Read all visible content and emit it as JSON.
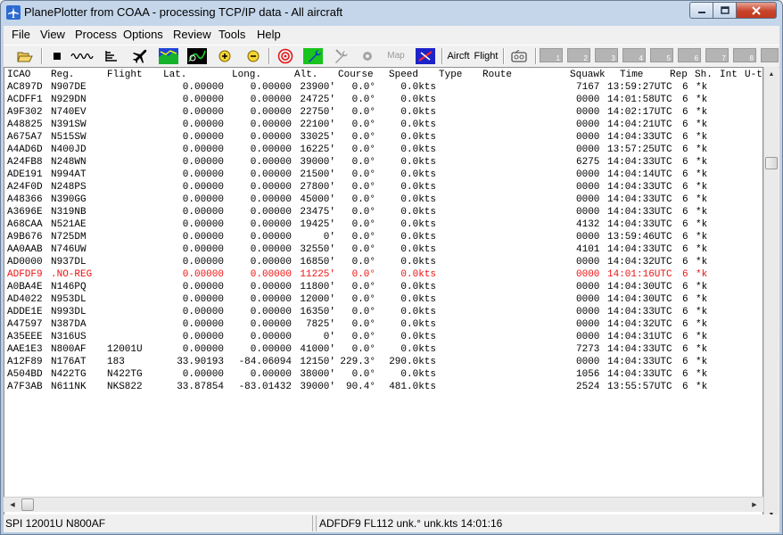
{
  "window": {
    "title": "PlanePlotter from COAA - processing TCP/IP data - All aircraft"
  },
  "menu": [
    "File",
    "View",
    "Process",
    "Options",
    "Review",
    "Tools",
    "Help"
  ],
  "toolbar": {
    "aircraft_label": "Aircft",
    "flight_label": "Flight",
    "map_label": "Map",
    "number_buttons": [
      "1",
      "2",
      "3",
      "4",
      "5",
      "6",
      "7",
      "8"
    ]
  },
  "columns": [
    "ICAO",
    "Reg.",
    "Flight",
    "Lat.",
    "Long.",
    "Alt.",
    "Course",
    "Speed",
    "Type",
    "Route",
    "Squawk",
    "Time",
    "Rep",
    "Sh.",
    "Int",
    "U-t"
  ],
  "aircraft": [
    {
      "icao": "AC897D",
      "reg": "N907DE",
      "flight": "",
      "lat": "0.00000",
      "lon": "0.00000",
      "alt": "23900'",
      "course": "0.0°",
      "speed": "0.0kts",
      "squawk": "7167",
      "time": "13:59:27UTC",
      "rep": "6",
      "sh": "*k",
      "red": false
    },
    {
      "icao": "ACDFF1",
      "reg": "N929DN",
      "flight": "",
      "lat": "0.00000",
      "lon": "0.00000",
      "alt": "24725'",
      "course": "0.0°",
      "speed": "0.0kts",
      "squawk": "0000",
      "time": "14:01:58UTC",
      "rep": "6",
      "sh": "*k",
      "red": false
    },
    {
      "icao": "A9F302",
      "reg": "N740EV",
      "flight": "",
      "lat": "0.00000",
      "lon": "0.00000",
      "alt": "22750'",
      "course": "0.0°",
      "speed": "0.0kts",
      "squawk": "0000",
      "time": "14:02:17UTC",
      "rep": "6",
      "sh": "*k",
      "red": false
    },
    {
      "icao": "A48825",
      "reg": "N391SW",
      "flight": "",
      "lat": "0.00000",
      "lon": "0.00000",
      "alt": "22100'",
      "course": "0.0°",
      "speed": "0.0kts",
      "squawk": "0000",
      "time": "14:04:21UTC",
      "rep": "6",
      "sh": "*k",
      "red": false
    },
    {
      "icao": "A675A7",
      "reg": "N515SW",
      "flight": "",
      "lat": "0.00000",
      "lon": "0.00000",
      "alt": "33025'",
      "course": "0.0°",
      "speed": "0.0kts",
      "squawk": "0000",
      "time": "14:04:33UTC",
      "rep": "6",
      "sh": "*k",
      "red": false
    },
    {
      "icao": "A4AD6D",
      "reg": "N400JD",
      "flight": "",
      "lat": "0.00000",
      "lon": "0.00000",
      "alt": "16225'",
      "course": "0.0°",
      "speed": "0.0kts",
      "squawk": "0000",
      "time": "13:57:25UTC",
      "rep": "6",
      "sh": "*k",
      "red": false
    },
    {
      "icao": "A24FB8",
      "reg": "N248WN",
      "flight": "",
      "lat": "0.00000",
      "lon": "0.00000",
      "alt": "39000'",
      "course": "0.0°",
      "speed": "0.0kts",
      "squawk": "6275",
      "time": "14:04:33UTC",
      "rep": "6",
      "sh": "*k",
      "red": false
    },
    {
      "icao": "ADE191",
      "reg": "N994AT",
      "flight": "",
      "lat": "0.00000",
      "lon": "0.00000",
      "alt": "21500'",
      "course": "0.0°",
      "speed": "0.0kts",
      "squawk": "0000",
      "time": "14:04:14UTC",
      "rep": "6",
      "sh": "*k",
      "red": false
    },
    {
      "icao": "A24F0D",
      "reg": "N248PS",
      "flight": "",
      "lat": "0.00000",
      "lon": "0.00000",
      "alt": "27800'",
      "course": "0.0°",
      "speed": "0.0kts",
      "squawk": "0000",
      "time": "14:04:33UTC",
      "rep": "6",
      "sh": "*k",
      "red": false
    },
    {
      "icao": "A48366",
      "reg": "N390GG",
      "flight": "",
      "lat": "0.00000",
      "lon": "0.00000",
      "alt": "45000'",
      "course": "0.0°",
      "speed": "0.0kts",
      "squawk": "0000",
      "time": "14:04:33UTC",
      "rep": "6",
      "sh": "*k",
      "red": false
    },
    {
      "icao": "A3696E",
      "reg": "N319NB",
      "flight": "",
      "lat": "0.00000",
      "lon": "0.00000",
      "alt": "23475'",
      "course": "0.0°",
      "speed": "0.0kts",
      "squawk": "0000",
      "time": "14:04:33UTC",
      "rep": "6",
      "sh": "*k",
      "red": false
    },
    {
      "icao": "A68CAA",
      "reg": "N521AE",
      "flight": "",
      "lat": "0.00000",
      "lon": "0.00000",
      "alt": "19425'",
      "course": "0.0°",
      "speed": "0.0kts",
      "squawk": "4132",
      "time": "14:04:33UTC",
      "rep": "6",
      "sh": "*k",
      "red": false
    },
    {
      "icao": "A9B676",
      "reg": "N725DM",
      "flight": "",
      "lat": "0.00000",
      "lon": "0.00000",
      "alt": "0'",
      "course": "0.0°",
      "speed": "0.0kts",
      "squawk": "0000",
      "time": "13:59:46UTC",
      "rep": "6",
      "sh": "*k",
      "red": false
    },
    {
      "icao": "AA0AAB",
      "reg": "N746UW",
      "flight": "",
      "lat": "0.00000",
      "lon": "0.00000",
      "alt": "32550'",
      "course": "0.0°",
      "speed": "0.0kts",
      "squawk": "4101",
      "time": "14:04:33UTC",
      "rep": "6",
      "sh": "*k",
      "red": false
    },
    {
      "icao": "AD0000",
      "reg": "N937DL",
      "flight": "",
      "lat": "0.00000",
      "lon": "0.00000",
      "alt": "16850'",
      "course": "0.0°",
      "speed": "0.0kts",
      "squawk": "0000",
      "time": "14:04:32UTC",
      "rep": "6",
      "sh": "*k",
      "red": false
    },
    {
      "icao": "ADFDF9",
      "reg": ".NO-REG",
      "flight": "",
      "lat": "0.00000",
      "lon": "0.00000",
      "alt": "11225'",
      "course": "0.0°",
      "speed": "0.0kts",
      "squawk": "0000",
      "time": "14:01:16UTC",
      "rep": "6",
      "sh": "*k",
      "red": true
    },
    {
      "icao": "A0BA4E",
      "reg": "N146PQ",
      "flight": "",
      "lat": "0.00000",
      "lon": "0.00000",
      "alt": "11800'",
      "course": "0.0°",
      "speed": "0.0kts",
      "squawk": "0000",
      "time": "14:04:30UTC",
      "rep": "6",
      "sh": "*k",
      "red": false
    },
    {
      "icao": "AD4022",
      "reg": "N953DL",
      "flight": "",
      "lat": "0.00000",
      "lon": "0.00000",
      "alt": "12000'",
      "course": "0.0°",
      "speed": "0.0kts",
      "squawk": "0000",
      "time": "14:04:30UTC",
      "rep": "6",
      "sh": "*k",
      "red": false
    },
    {
      "icao": "ADDE1E",
      "reg": "N993DL",
      "flight": "",
      "lat": "0.00000",
      "lon": "0.00000",
      "alt": "16350'",
      "course": "0.0°",
      "speed": "0.0kts",
      "squawk": "0000",
      "time": "14:04:33UTC",
      "rep": "6",
      "sh": "*k",
      "red": false
    },
    {
      "icao": "A47597",
      "reg": "N387DA",
      "flight": "",
      "lat": "0.00000",
      "lon": "0.00000",
      "alt": "7825'",
      "course": "0.0°",
      "speed": "0.0kts",
      "squawk": "0000",
      "time": "14:04:32UTC",
      "rep": "6",
      "sh": "*k",
      "red": false
    },
    {
      "icao": "A35EEE",
      "reg": "N316US",
      "flight": "",
      "lat": "0.00000",
      "lon": "0.00000",
      "alt": "0'",
      "course": "0.0°",
      "speed": "0.0kts",
      "squawk": "0000",
      "time": "14:04:31UTC",
      "rep": "6",
      "sh": "*k",
      "red": false
    },
    {
      "icao": "AAE1E3",
      "reg": "N800AF",
      "flight": "12001U",
      "lat": "0.00000",
      "lon": "0.00000",
      "alt": "41000'",
      "course": "0.0°",
      "speed": "0.0kts",
      "squawk": "7273",
      "time": "14:04:33UTC",
      "rep": "6",
      "sh": "*k",
      "red": false
    },
    {
      "icao": "A12F89",
      "reg": "N176AT",
      "flight": "183",
      "lat": "33.90193",
      "lon": "-84.06094",
      "alt": "12150'",
      "course": "229.3°",
      "speed": "290.0kts",
      "squawk": "0000",
      "time": "14:04:33UTC",
      "rep": "6",
      "sh": "*k",
      "red": false
    },
    {
      "icao": "A504BD",
      "reg": "N422TG",
      "flight": "N422TG",
      "lat": "0.00000",
      "lon": "0.00000",
      "alt": "38000'",
      "course": "0.0°",
      "speed": "0.0kts",
      "squawk": "1056",
      "time": "14:04:33UTC",
      "rep": "6",
      "sh": "*k",
      "red": false
    },
    {
      "icao": "A7F3AB",
      "reg": "N611NK",
      "flight": "NKS822",
      "lat": "33.87854",
      "lon": "-83.01432",
      "alt": "39000'",
      "course": "90.4°",
      "speed": "481.0kts",
      "squawk": "2524",
      "time": "13:55:57UTC",
      "rep": "6",
      "sh": "*k",
      "red": false
    }
  ],
  "status": {
    "left": "SPI 12001U   N800AF",
    "right": "ADFDF9 FL112 unk.° unk.kts 14:01:16"
  },
  "colors": {
    "highlight_row": "#e11111",
    "close_button": "#c7432a"
  }
}
